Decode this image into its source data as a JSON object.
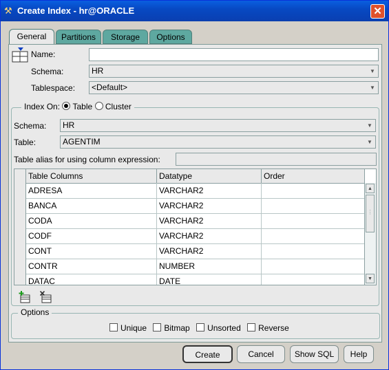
{
  "window": {
    "title": "Create Index - hr@ORACLE",
    "close_label": "✕"
  },
  "tabs": [
    {
      "label": "General",
      "active": true
    },
    {
      "label": "Partitions",
      "active": false
    },
    {
      "label": "Storage",
      "active": false
    },
    {
      "label": "Options",
      "active": false
    }
  ],
  "general": {
    "name_label": "Name:",
    "name_value": "",
    "schema_label": "Schema:",
    "schema_value": "HR",
    "tablespace_label": "Tablespace:",
    "tablespace_value": "<Default>"
  },
  "index_on": {
    "legend": "Index On:",
    "option_table": "Table",
    "option_cluster": "Cluster",
    "selected": "Table",
    "schema_label": "Schema:",
    "schema_value": "HR",
    "table_label": "Table:",
    "table_value": "AGENTIM",
    "alias_label": "Table alias for using column expression:",
    "alias_value": ""
  },
  "columns_table": {
    "headers": [
      "Table Columns",
      "Datatype",
      "Order"
    ],
    "rows": [
      {
        "column": "ADRESA",
        "datatype": "VARCHAR2",
        "order": ""
      },
      {
        "column": "BANCA",
        "datatype": "VARCHAR2",
        "order": ""
      },
      {
        "column": "CODA",
        "datatype": "VARCHAR2",
        "order": ""
      },
      {
        "column": "CODF",
        "datatype": "VARCHAR2",
        "order": ""
      },
      {
        "column": "CONT",
        "datatype": "VARCHAR2",
        "order": ""
      },
      {
        "column": "CONTR",
        "datatype": "NUMBER",
        "order": ""
      },
      {
        "column": "DATAC",
        "datatype": "DATE",
        "order": ""
      }
    ]
  },
  "options": {
    "legend": "Options",
    "unique": "Unique",
    "bitmap": "Bitmap",
    "unsorted": "Unsorted",
    "reverse": "Reverse"
  },
  "buttons": {
    "create": "Create",
    "cancel": "Cancel",
    "show_sql": "Show SQL",
    "help": "Help"
  },
  "icons": [
    "app-icon",
    "index-icon",
    "add-row-icon",
    "delete-row-icon",
    "dropdown-arrow-icon",
    "scroll-up-icon",
    "scroll-down-icon"
  ],
  "colors": {
    "titlebar": "#0749c3",
    "tab_inactive": "#5ea8a0",
    "panel": "#e9e9e9",
    "close": "#e0512c"
  }
}
